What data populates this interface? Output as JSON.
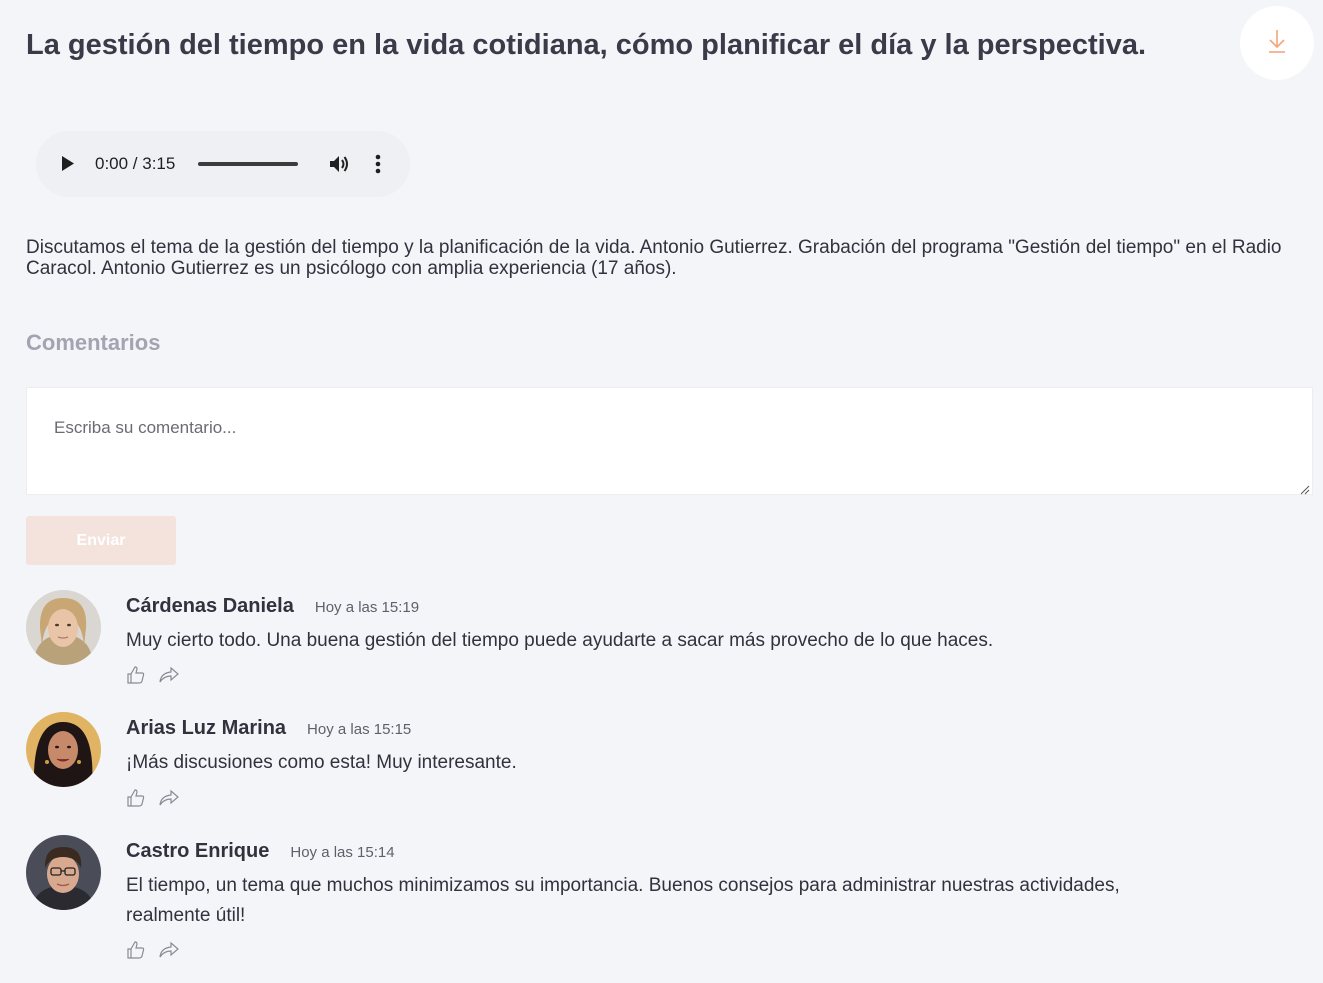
{
  "page": {
    "title": "La gestión del tiempo en la vida cotidiana, cómo planificar el día y la perspectiva."
  },
  "icons": {
    "download": "download-arrow-icon",
    "play": "play-icon",
    "volume": "volume-icon",
    "more": "more-vertical-icon",
    "like": "thumbs-up-icon",
    "share": "share-icon"
  },
  "colors": {
    "accent": "#f5a37a",
    "background": "#f4f5f9",
    "send_button_disabled": "#f4e2dc",
    "heading_muted": "#a3a3b2"
  },
  "audio": {
    "time": "0:00 / 3:15",
    "progress": 0
  },
  "description": "Discutamos el tema de la gestión del tiempo y la planificación de la vida. Antonio Gutierrez. Grabación del programa \"Gestión del tiempo\" en el Radio Caracol. Antonio Gutierrez es un psicólogo con amplia experiencia (17 años).",
  "comments_section": {
    "heading": "Comentarios",
    "placeholder": "Escriba su comentario...",
    "send_label": "Enviar",
    "items": [
      {
        "author": "Cárdenas Daniela",
        "time": "Hoy a las 15:19",
        "text": "Muy cierto todo. Una buena gestión del tiempo puede ayudarte a sacar más provecho de lo que haces."
      },
      {
        "author": "Arias Luz Marina",
        "time": "Hoy a las 15:15",
        "text": "¡Más discusiones como esta! Muy interesante."
      },
      {
        "author": "Castro Enrique",
        "time": "Hoy a las 15:14",
        "text": "El tiempo, un tema que muchos minimizamos su importancia. Buenos consejos para administrar nuestras actividades, realmente útil!"
      }
    ]
  }
}
